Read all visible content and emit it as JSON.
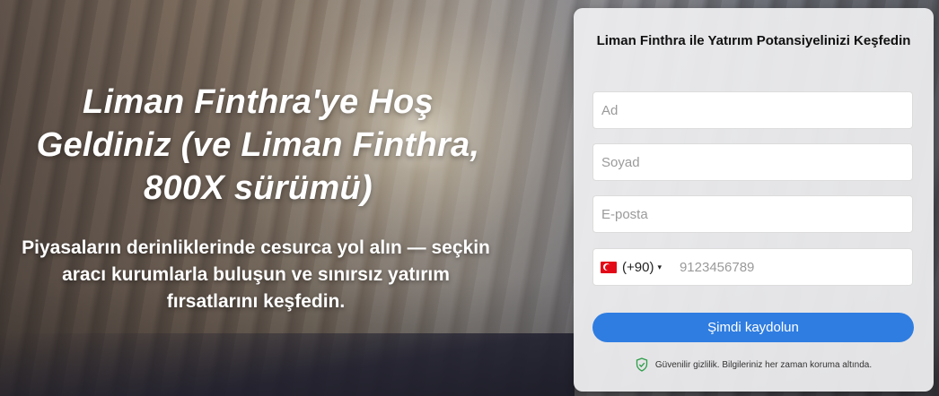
{
  "hero": {
    "headline": "Liman Finthra'ye Hoş Geldiniz (ve Liman Finthra, 800X sürümü)",
    "subtext": "Piyasaların derinliklerinde cesurca yol alın — seçkin aracı kurumlarla buluşun ve sınırsız yatırım fırsatlarını keşfedin."
  },
  "form": {
    "title": "Liman Finthra ile Yatırım Potansiyelinizi Keşfedin",
    "first_name_placeholder": "Ad",
    "last_name_placeholder": "Soyad",
    "email_placeholder": "E-posta",
    "phone": {
      "country_flag": "turkey-flag-icon",
      "dial_code": "(+90)",
      "caret": "▾",
      "placeholder": "9123456789"
    },
    "submit_label": "Şimdi kaydolun",
    "privacy_note": "Güvenilir gizlilik. Bilgileriniz her zaman koruma altında."
  },
  "colors": {
    "accent": "#2f7de1",
    "shield": "#2e9e4a",
    "flag_red": "#e30a17"
  }
}
